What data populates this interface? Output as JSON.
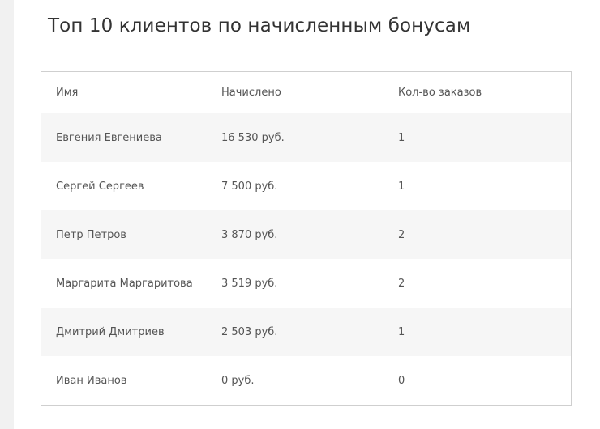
{
  "page": {
    "title": "Топ 10 клиентов по начисленным бонусам"
  },
  "table": {
    "headers": {
      "name": "Имя",
      "amount": "Начислено",
      "orders": "Кол-во заказов"
    },
    "rows": [
      {
        "name": "Евгения Евгениева",
        "amount": "16 530 руб.",
        "orders": "1"
      },
      {
        "name": "Сергей Сергеев",
        "amount": "7 500 руб.",
        "orders": "1"
      },
      {
        "name": "Петр Петров",
        "amount": "3 870 руб.",
        "orders": "2"
      },
      {
        "name": "Маргарита Маргаритова",
        "amount": "3 519 руб.",
        "orders": "2"
      },
      {
        "name": "Дмитрий Дмитриев",
        "amount": "2 503 руб.",
        "orders": "1"
      },
      {
        "name": "Иван Иванов",
        "amount": "0 руб.",
        "orders": "0"
      }
    ]
  },
  "colors": {
    "page_background": "#f1f1f1",
    "card_background": "#ffffff",
    "stripe": "#f6f6f6",
    "border": "#cfcfcf",
    "title_text": "#333333",
    "cell_text": "#555555"
  }
}
